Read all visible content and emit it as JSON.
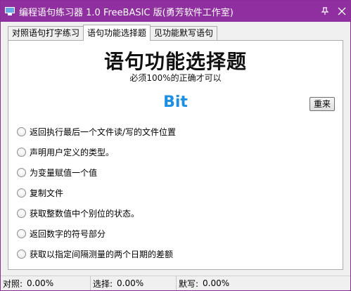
{
  "window": {
    "title": "编程语句练习器 1.0 FreeBASIC 版(勇芳软件工作室)",
    "accent_color": "#8f2fa0",
    "icons": {
      "app": "monitor-icon",
      "pin": "pin-icon",
      "close": "close-icon"
    }
  },
  "tabs": [
    {
      "label": "对照语句打字练习",
      "active": false
    },
    {
      "label": "语句功能选择题",
      "active": true
    },
    {
      "label": "见功能默写语句",
      "active": false
    }
  ],
  "main": {
    "title": "语句功能选择题",
    "subtitle": "必须100%的正确才可以",
    "word": "Bit",
    "word_color": "#1a8fe3",
    "reset_label": "重来",
    "options": [
      "返回执行最后一个文件读/写的文件位置",
      "声明用户定义的类型。",
      "为变量赋值一个值",
      "复制文件",
      "获取整数值中个别位的状态。",
      "返回数字的符号部分",
      "获取以指定间隔测量的两个日期的差额"
    ]
  },
  "status": {
    "typing_label": "对照:",
    "typing_value": "0.00%",
    "choice_label": "选择:",
    "choice_value": "0.00%",
    "dictation_label": "默写:",
    "dictation_value": "0.00%"
  }
}
